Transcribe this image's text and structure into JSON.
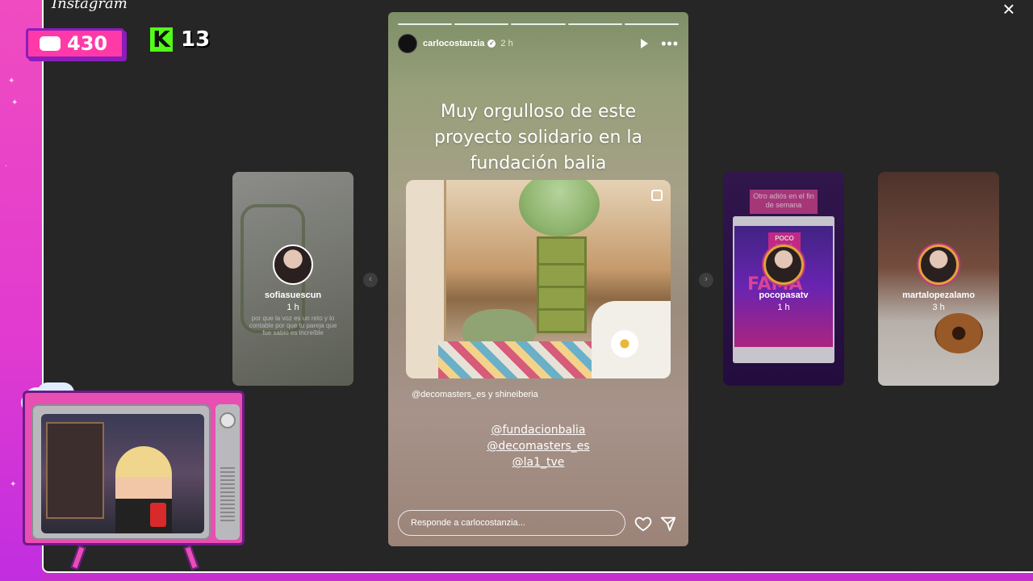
{
  "app": {
    "logo_text": "Instagram",
    "close_label": "×"
  },
  "overlay": {
    "chat_count": "430",
    "kick_letter": "K",
    "kick_count": "13"
  },
  "stories_side": [
    {
      "username": "sofiasuescun",
      "time": "1 h",
      "caption_faint": "por que la voz es un reto\ny lo contable por que tu pareja\nque fue sabio es increíble"
    },
    {
      "username": "pocopasatv",
      "time": "1 h",
      "tag_text": "Otro adiós en el fin de semana",
      "post_badge": "POCO PASA",
      "post_big_word": "FAMA"
    },
    {
      "username": "martalopezalamo",
      "time": "3 h"
    }
  ],
  "story": {
    "username": "carlocostanzia",
    "verified_icon": "verified-badge-icon",
    "time": "2 h",
    "progress_total": 5,
    "progress_done": 5,
    "headline": "Muy orgulloso de este proyecto solidario en la fundación balia",
    "mention_a": "@decomasters_es",
    "mention_join": "y",
    "mention_b": "shineiberia",
    "links": [
      "@fundacionbalia",
      "@decomasters_es",
      "@la1_tve"
    ],
    "reply_placeholder": "Responde a carlocostanzia..."
  },
  "icons": {
    "close": "close-icon",
    "play": "play-icon",
    "more": "more-icon",
    "heart": "heart-icon",
    "send": "send-icon",
    "prev": "chevron-left-icon",
    "next": "chevron-right-icon"
  },
  "colors": {
    "app_bg": "#262626",
    "stream_frame": "#e040c8",
    "chat_badge": "#ff3aa8",
    "kick_green": "#53fc18"
  }
}
